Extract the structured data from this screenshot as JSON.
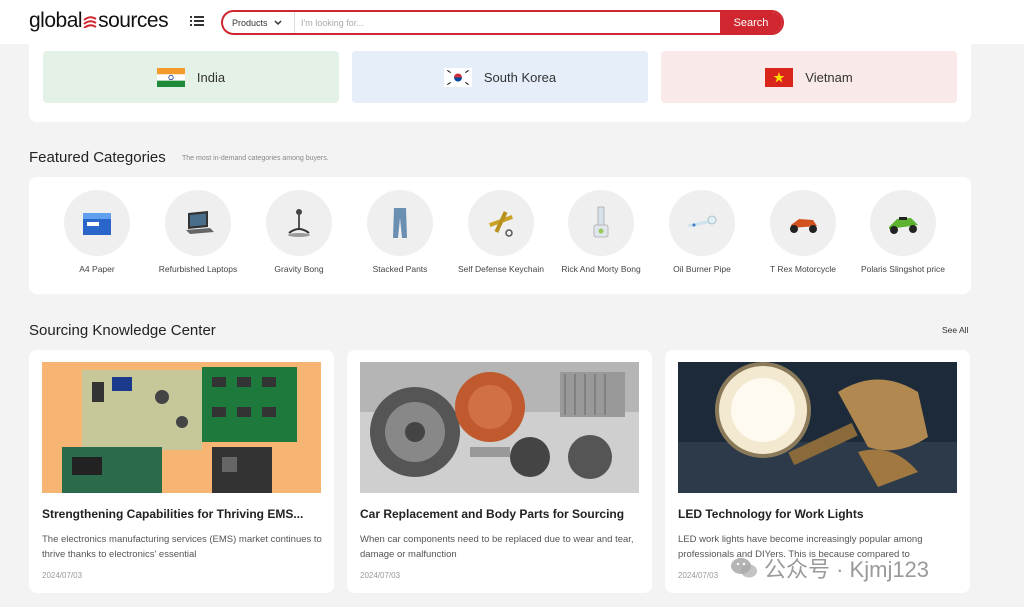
{
  "header": {
    "logo_left": "global",
    "logo_right": "sources",
    "search": {
      "category": "Products",
      "placeholder": "I'm looking for...",
      "button": "Search"
    }
  },
  "countries": [
    {
      "name": "India",
      "flag": "india-flag"
    },
    {
      "name": "South Korea",
      "flag": "south-korea-flag"
    },
    {
      "name": "Vietnam",
      "flag": "vietnam-flag"
    }
  ],
  "featured": {
    "title": "Featured Categories",
    "subtitle": "The most in-demand categories among buyers.",
    "items": [
      {
        "label": "A4 Paper"
      },
      {
        "label": "Refurbished Laptops"
      },
      {
        "label": "Gravity Bong"
      },
      {
        "label": "Stacked Pants"
      },
      {
        "label": "Self Defense Keychain"
      },
      {
        "label": "Rick And Morty Bong"
      },
      {
        "label": "Oil Burner Pipe"
      },
      {
        "label": "T Rex Motorcycle"
      },
      {
        "label": "Polaris Slingshot price"
      }
    ]
  },
  "knowledge": {
    "title": "Sourcing Knowledge Center",
    "see_all": "See All",
    "cards": [
      {
        "title": "Strengthening Capabilities for Thriving EMS...",
        "desc": "The electronics manufacturing services (EMS) market continues to thrive thanks to electronics' essential",
        "date": "2024/07/03"
      },
      {
        "title": "Car Replacement and Body Parts for Sourcing",
        "desc": "When car components need to be replaced due to wear and tear, damage or malfunction",
        "date": "2024/07/03"
      },
      {
        "title": "LED Technology for Work Lights",
        "desc": "LED work lights have become increasingly popular among professionals and DIYers. This is because compared to",
        "date": "2024/07/03"
      }
    ]
  },
  "watermark": {
    "text": "公众号 · Kjmj123"
  },
  "colors": {
    "brand_red": "#d0262f",
    "india_bg": "#e3f1e6",
    "korea_bg": "#e5eef9",
    "vietnam_bg": "#f9e9e8"
  }
}
